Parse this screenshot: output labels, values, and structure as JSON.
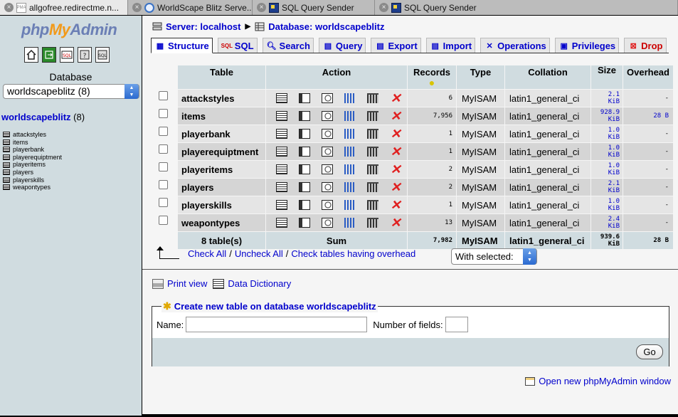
{
  "browser_tabs": [
    {
      "title": "allgofree.redirectme.n...",
      "favicon": "pma-icon"
    },
    {
      "title": "WorldScape Blitz Serve...",
      "favicon": "globe-icon"
    },
    {
      "title": "SQL Query Sender",
      "favicon": "sql-app-icon"
    },
    {
      "title": "SQL Query Sender",
      "favicon": "sql-app-icon"
    }
  ],
  "sidebar": {
    "logo_php": "php",
    "logo_my": "My",
    "logo_admin": "Admin",
    "nav_icons": [
      "home-icon",
      "exit-icon",
      "sql-icon",
      "query-window-icon",
      "docs-icon"
    ],
    "database_label": "Database",
    "db_select_value": "worldscapeblitz (8)",
    "db_title": "worldscapeblitz",
    "db_count": "(8)",
    "tables": [
      "attackstyles",
      "items",
      "playerbank",
      "playerequiptment",
      "playeritems",
      "players",
      "playerskills",
      "weapontypes"
    ]
  },
  "breadcrumb": {
    "server": "Server: localhost",
    "database": "Database: worldscapeblitz"
  },
  "tabs": [
    {
      "label": "Structure",
      "icon": "structure-icon",
      "active": true
    },
    {
      "label": "SQL",
      "icon": "sql-icon"
    },
    {
      "label": "Search",
      "icon": "search-icon"
    },
    {
      "label": "Query",
      "icon": "query-icon"
    },
    {
      "label": "Export",
      "icon": "export-icon"
    },
    {
      "label": "Import",
      "icon": "import-icon"
    },
    {
      "label": "Operations",
      "icon": "operations-icon"
    },
    {
      "label": "Privileges",
      "icon": "privileges-icon"
    },
    {
      "label": "Drop",
      "icon": "drop-icon"
    }
  ],
  "table": {
    "headers": {
      "table": "Table",
      "action": "Action",
      "records": "Records",
      "type": "Type",
      "collation": "Collation",
      "size": "Size",
      "overhead": "Overhead"
    },
    "rows": [
      {
        "name": "attackstyles",
        "records": "6",
        "type": "MyISAM",
        "collation": "latin1_general_ci",
        "size1": "2.1",
        "size2": "KiB",
        "overhead": "-"
      },
      {
        "name": "items",
        "records": "7,956",
        "type": "MyISAM",
        "collation": "latin1_general_ci",
        "size1": "928.9",
        "size2": "KiB",
        "overhead": "28 B"
      },
      {
        "name": "playerbank",
        "records": "1",
        "type": "MyISAM",
        "collation": "latin1_general_ci",
        "size1": "1.0",
        "size2": "KiB",
        "overhead": "-"
      },
      {
        "name": "playerequiptment",
        "records": "1",
        "type": "MyISAM",
        "collation": "latin1_general_ci",
        "size1": "1.0",
        "size2": "KiB",
        "overhead": "-"
      },
      {
        "name": "playeritems",
        "records": "2",
        "type": "MyISAM",
        "collation": "latin1_general_ci",
        "size1": "1.0",
        "size2": "KiB",
        "overhead": "-"
      },
      {
        "name": "players",
        "records": "2",
        "type": "MyISAM",
        "collation": "latin1_general_ci",
        "size1": "2.1",
        "size2": "KiB",
        "overhead": "-"
      },
      {
        "name": "playerskills",
        "records": "1",
        "type": "MyISAM",
        "collation": "latin1_general_ci",
        "size1": "1.0",
        "size2": "KiB",
        "overhead": "-"
      },
      {
        "name": "weapontypes",
        "records": "13",
        "type": "MyISAM",
        "collation": "latin1_general_ci",
        "size1": "2.4",
        "size2": "KiB",
        "overhead": "-"
      }
    ],
    "summary": {
      "count": "8 table(s)",
      "label": "Sum",
      "records": "7,982",
      "type": "MyISAM",
      "collation": "latin1_general_ci",
      "size1": "939.6",
      "size2": "KiB",
      "overhead": "28 B"
    }
  },
  "bulk": {
    "check_all": "Check All",
    "uncheck_all": "Uncheck All",
    "check_overhead": "Check tables having overhead",
    "with_selected": "With selected:"
  },
  "links": {
    "print_view": "Print view",
    "data_dictionary": "Data Dictionary"
  },
  "create_table": {
    "legend": "Create new table on database worldscapeblitz",
    "name_label": "Name:",
    "name_value": "",
    "fields_label": "Number of fields:",
    "fields_value": "",
    "go_label": "Go"
  },
  "open_new_window": "Open new phpMyAdmin window"
}
